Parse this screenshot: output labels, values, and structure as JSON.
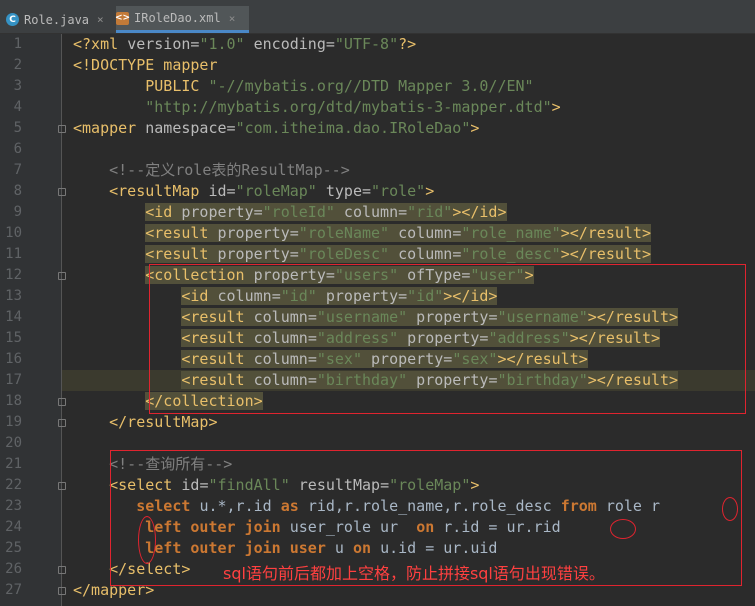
{
  "tabs": [
    {
      "label": "Role.java",
      "icon": "java-class-icon",
      "active": false
    },
    {
      "label": "IRoleDao.xml",
      "icon": "xml-file-icon",
      "active": true
    }
  ],
  "close_glyph": "×",
  "code_lines": [
    [
      {
        "t": "<?xml ",
        "c": "tag"
      },
      {
        "t": "version",
        "c": "attr"
      },
      {
        "t": "=",
        "c": "attr"
      },
      {
        "t": "\"1.0\"",
        "c": "val"
      },
      {
        "t": " encoding",
        "c": "attr"
      },
      {
        "t": "=",
        "c": "attr"
      },
      {
        "t": "\"UTF-8\"",
        "c": "val"
      },
      {
        "t": "?>",
        "c": "tag"
      }
    ],
    [
      {
        "t": "<!DOCTYPE mapper",
        "c": "tag"
      }
    ],
    [
      {
        "t": "        PUBLIC ",
        "c": "tag"
      },
      {
        "t": "\"-//mybatis.org//DTD Mapper 3.0//EN\"",
        "c": "val"
      }
    ],
    [
      {
        "t": "        \"http://mybatis.org/dtd/mybatis-3-mapper.dtd\"",
        "c": "val"
      },
      {
        "t": ">",
        "c": "tag"
      }
    ],
    [
      {
        "t": "<mapper ",
        "c": "tag"
      },
      {
        "t": "namespace",
        "c": "attr"
      },
      {
        "t": "=",
        "c": "attr"
      },
      {
        "t": "\"com.itheima.dao.IRoleDao\"",
        "c": "val"
      },
      {
        "t": ">",
        "c": "tag"
      }
    ],
    [],
    [
      {
        "t": "    <!--定义role表的ResultMap-->",
        "c": "comment"
      }
    ],
    [
      {
        "t": "    <resultMap ",
        "c": "tag"
      },
      {
        "t": "id",
        "c": "attr"
      },
      {
        "t": "=",
        "c": "attr"
      },
      {
        "t": "\"roleMap\"",
        "c": "val"
      },
      {
        "t": " type",
        "c": "attr"
      },
      {
        "t": "=",
        "c": "attr"
      },
      {
        "t": "\"role\"",
        "c": "val"
      },
      {
        "t": ">",
        "c": "tag"
      }
    ],
    [
      {
        "t": "        "
      },
      {
        "t": "<id ",
        "c": "tag",
        "h": 1
      },
      {
        "t": "property",
        "c": "attr",
        "h": 1
      },
      {
        "t": "=",
        "c": "attr",
        "h": 1
      },
      {
        "t": "\"roleId\"",
        "c": "val",
        "h": 1
      },
      {
        "t": " column",
        "c": "attr",
        "h": 1
      },
      {
        "t": "=",
        "c": "attr",
        "h": 1
      },
      {
        "t": "\"rid\"",
        "c": "val",
        "h": 1
      },
      {
        "t": "></id>",
        "c": "tag",
        "h": 1
      }
    ],
    [
      {
        "t": "        "
      },
      {
        "t": "<result ",
        "c": "tag",
        "h": 1
      },
      {
        "t": "property",
        "c": "attr",
        "h": 1
      },
      {
        "t": "=",
        "c": "attr",
        "h": 1
      },
      {
        "t": "\"roleName\"",
        "c": "val",
        "h": 1
      },
      {
        "t": " column",
        "c": "attr",
        "h": 1
      },
      {
        "t": "=",
        "c": "attr",
        "h": 1
      },
      {
        "t": "\"role_name\"",
        "c": "val",
        "h": 1
      },
      {
        "t": "></result>",
        "c": "tag",
        "h": 1
      }
    ],
    [
      {
        "t": "        "
      },
      {
        "t": "<result ",
        "c": "tag",
        "h": 1
      },
      {
        "t": "property",
        "c": "attr",
        "h": 1
      },
      {
        "t": "=",
        "c": "attr",
        "h": 1
      },
      {
        "t": "\"roleDesc\"",
        "c": "val",
        "h": 1
      },
      {
        "t": " column",
        "c": "attr",
        "h": 1
      },
      {
        "t": "=",
        "c": "attr",
        "h": 1
      },
      {
        "t": "\"role_desc\"",
        "c": "val",
        "h": 1
      },
      {
        "t": "></result>",
        "c": "tag",
        "h": 1
      }
    ],
    [
      {
        "t": "        "
      },
      {
        "t": "<collection ",
        "c": "tag",
        "h": 1
      },
      {
        "t": "property",
        "c": "attr",
        "h": 1
      },
      {
        "t": "=",
        "c": "attr",
        "h": 1
      },
      {
        "t": "\"users\"",
        "c": "val",
        "h": 1
      },
      {
        "t": " ofType",
        "c": "attr",
        "h": 1
      },
      {
        "t": "=",
        "c": "attr",
        "h": 1
      },
      {
        "t": "\"user\"",
        "c": "val",
        "h": 1
      },
      {
        "t": ">",
        "c": "tag",
        "h": 1
      }
    ],
    [
      {
        "t": "            "
      },
      {
        "t": "<id ",
        "c": "tag",
        "h": 1
      },
      {
        "t": "column",
        "c": "attr",
        "h": 1
      },
      {
        "t": "=",
        "c": "attr",
        "h": 1
      },
      {
        "t": "\"id\"",
        "c": "val",
        "h": 1
      },
      {
        "t": " property",
        "c": "attr",
        "h": 1
      },
      {
        "t": "=",
        "c": "attr",
        "h": 1
      },
      {
        "t": "\"id\"",
        "c": "val",
        "h": 1
      },
      {
        "t": "></id>",
        "c": "tag",
        "h": 1
      }
    ],
    [
      {
        "t": "            "
      },
      {
        "t": "<result ",
        "c": "tag",
        "h": 1
      },
      {
        "t": "column",
        "c": "attr",
        "h": 1
      },
      {
        "t": "=",
        "c": "attr",
        "h": 1
      },
      {
        "t": "\"username\"",
        "c": "val",
        "h": 1
      },
      {
        "t": " property",
        "c": "attr",
        "h": 1
      },
      {
        "t": "=",
        "c": "attr",
        "h": 1
      },
      {
        "t": "\"username\"",
        "c": "val",
        "h": 1
      },
      {
        "t": "></result>",
        "c": "tag",
        "h": 1
      }
    ],
    [
      {
        "t": "            "
      },
      {
        "t": "<result ",
        "c": "tag",
        "h": 1
      },
      {
        "t": "column",
        "c": "attr",
        "h": 1
      },
      {
        "t": "=",
        "c": "attr",
        "h": 1
      },
      {
        "t": "\"address\"",
        "c": "val",
        "h": 1
      },
      {
        "t": " property",
        "c": "attr",
        "h": 1
      },
      {
        "t": "=",
        "c": "attr",
        "h": 1
      },
      {
        "t": "\"address\"",
        "c": "val",
        "h": 1
      },
      {
        "t": "></result>",
        "c": "tag",
        "h": 1
      }
    ],
    [
      {
        "t": "            "
      },
      {
        "t": "<result ",
        "c": "tag",
        "h": 1
      },
      {
        "t": "column",
        "c": "attr",
        "h": 1
      },
      {
        "t": "=",
        "c": "attr",
        "h": 1
      },
      {
        "t": "\"sex\"",
        "c": "val",
        "h": 1
      },
      {
        "t": " property",
        "c": "attr",
        "h": 1
      },
      {
        "t": "=",
        "c": "attr",
        "h": 1
      },
      {
        "t": "\"sex\"",
        "c": "val",
        "h": 1
      },
      {
        "t": "></result>",
        "c": "tag",
        "h": 1
      }
    ],
    [
      {
        "t": "            "
      },
      {
        "t": "<result ",
        "c": "tag",
        "h": 1
      },
      {
        "t": "column",
        "c": "attr",
        "h": 1
      },
      {
        "t": "=",
        "c": "attr",
        "h": 1
      },
      {
        "t": "\"birthday\"",
        "c": "val",
        "h": 1
      },
      {
        "t": " property",
        "c": "attr",
        "h": 1
      },
      {
        "t": "=",
        "c": "attr",
        "h": 1
      },
      {
        "t": "\"birthday\"",
        "c": "val",
        "h": 1
      },
      {
        "t": "></result>",
        "c": "tag",
        "h": 1
      }
    ],
    [
      {
        "t": "        "
      },
      {
        "t": "</collection>",
        "c": "tag",
        "h": 1
      }
    ],
    [
      {
        "t": "    </resultMap>",
        "c": "tag"
      }
    ],
    [],
    [
      {
        "t": "    <!--查询所有-->",
        "c": "comment"
      }
    ],
    [
      {
        "t": "    <select ",
        "c": "tag"
      },
      {
        "t": "id",
        "c": "attr"
      },
      {
        "t": "=",
        "c": "attr"
      },
      {
        "t": "\"findAll\"",
        "c": "val"
      },
      {
        "t": " resultMap",
        "c": "attr"
      },
      {
        "t": "=",
        "c": "attr"
      },
      {
        "t": "\"roleMap\"",
        "c": "val"
      },
      {
        "t": ">",
        "c": "tag"
      }
    ],
    [
      {
        "t": "       "
      },
      {
        "t": "select ",
        "c": "kw"
      },
      {
        "t": "u.*,r.id ",
        "c": "sql"
      },
      {
        "t": "as ",
        "c": "kw"
      },
      {
        "t": "rid,r.role_name,r.role_desc ",
        "c": "sql"
      },
      {
        "t": "from ",
        "c": "kw"
      },
      {
        "t": "role r",
        "c": "sql"
      }
    ],
    [
      {
        "t": "        "
      },
      {
        "t": "left outer join ",
        "c": "kw"
      },
      {
        "t": "user_role ur  ",
        "c": "sql"
      },
      {
        "t": "on ",
        "c": "kw"
      },
      {
        "t": "r.id = ur.rid",
        "c": "sql"
      }
    ],
    [
      {
        "t": "        "
      },
      {
        "t": "left outer join user ",
        "c": "kw"
      },
      {
        "t": "u ",
        "c": "sql"
      },
      {
        "t": "on ",
        "c": "kw"
      },
      {
        "t": "u.id = ur.uid",
        "c": "sql"
      }
    ],
    [
      {
        "t": "    </select>",
        "c": "tag"
      }
    ],
    [
      {
        "t": "</mapper>",
        "c": "tag"
      }
    ]
  ],
  "annotation_note": "sql语句前后都加上空格，防止拼接sql语句出现错误。"
}
